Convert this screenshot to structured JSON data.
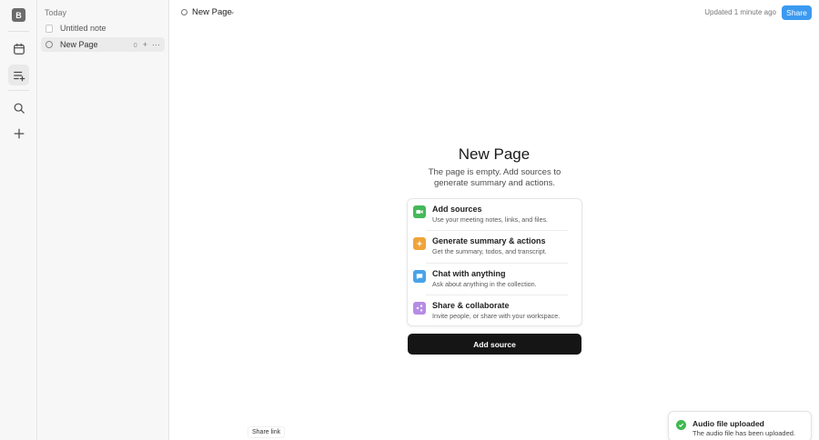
{
  "rail": {
    "avatar_letter": "B",
    "buttons": [
      "calendar-icon",
      "list-add-icon",
      "search-icon",
      "plus-icon"
    ]
  },
  "sidebar": {
    "section_label": "Today",
    "items": [
      {
        "label": "Untitled note",
        "type": "note"
      },
      {
        "label": "New Page",
        "type": "page",
        "count": "0",
        "active": true
      }
    ]
  },
  "topbar": {
    "page_title": "New Page",
    "updated_text": "Updated 1 minute ago",
    "share_label": "Share"
  },
  "main": {
    "title": "New Page",
    "subtitle": "The page is empty. Add sources to generate summary and actions.",
    "features": [
      {
        "title": "Add sources",
        "desc": "Use your meeting notes, links, and files.",
        "color": "#46b85a",
        "icon": "video-icon"
      },
      {
        "title": "Generate summary & actions",
        "desc": "Get the summary, todos, and transcript.",
        "color": "#f0a43a",
        "icon": "sparkle-icon"
      },
      {
        "title": "Chat with anything",
        "desc": "Ask about anything in the collection.",
        "color": "#4aa3e8",
        "icon": "chat-icon"
      },
      {
        "title": "Share & collaborate",
        "desc": "Invite people, or share with your workspace.",
        "color": "#b68ce6",
        "icon": "share-icon"
      }
    ],
    "cta_label": "Add source"
  },
  "share_link_label": "Share link",
  "toast": {
    "title": "Audio file uploaded",
    "desc": "The audio file has been uploaded."
  }
}
